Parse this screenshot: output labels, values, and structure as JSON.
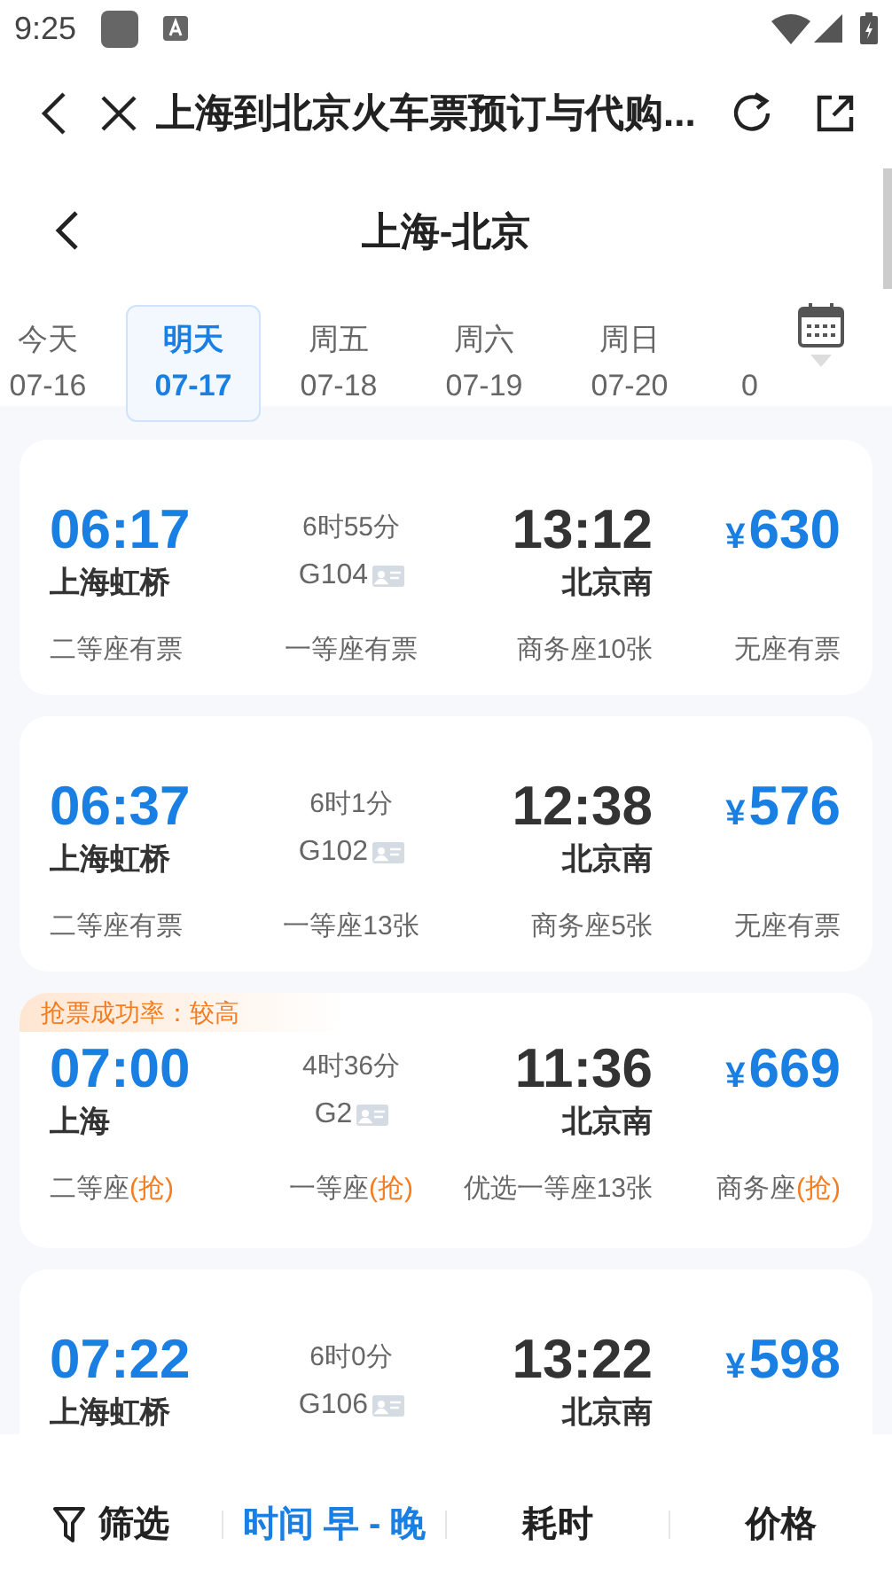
{
  "status_bar": {
    "time": "9:25"
  },
  "browser_bar": {
    "title": "上海到北京火车票预订与代购..."
  },
  "header": {
    "title": "上海-北京"
  },
  "dates": [
    {
      "day": "今天",
      "date": "07-16",
      "selected": false
    },
    {
      "day": "明天",
      "date": "07-17",
      "selected": true
    },
    {
      "day": "周五",
      "date": "07-18",
      "selected": false
    },
    {
      "day": "周六",
      "date": "07-19",
      "selected": false
    },
    {
      "day": "周日",
      "date": "07-20",
      "selected": false
    },
    {
      "date": "0",
      "selected": false
    }
  ],
  "trains": [
    {
      "depart": "06:17",
      "from": "上海虹桥",
      "duration": "6时55分",
      "number": "G104",
      "arrive": "13:12",
      "to": "北京南",
      "price": "630",
      "seats": [
        {
          "text": "二等座有票"
        },
        {
          "text": "一等座有票"
        },
        {
          "text": "商务座10张"
        },
        {
          "text": "无座有票"
        }
      ]
    },
    {
      "depart": "06:37",
      "from": "上海虹桥",
      "duration": "6时1分",
      "number": "G102",
      "arrive": "12:38",
      "to": "北京南",
      "price": "576",
      "seats": [
        {
          "text": "二等座有票"
        },
        {
          "text": "一等座13张"
        },
        {
          "text": "商务座5张"
        },
        {
          "text": "无座有票"
        }
      ]
    },
    {
      "tag": "抢票成功率：较高",
      "depart": "07:00",
      "from": "上海",
      "duration": "4时36分",
      "number": "G2",
      "arrive": "11:36",
      "to": "北京南",
      "price": "669",
      "seats": [
        {
          "text": "二等座",
          "grab": "(抢)"
        },
        {
          "text": "一等座",
          "grab": "(抢)"
        },
        {
          "text": "优选一等座13张"
        },
        {
          "text": "商务座",
          "grab": "(抢)"
        }
      ]
    },
    {
      "depart": "07:22",
      "from": "上海虹桥",
      "duration": "6时0分",
      "number": "G106",
      "arrive": "13:22",
      "to": "北京南",
      "price": "598"
    }
  ],
  "currency": "¥",
  "sort_bar": [
    {
      "kind": "filter",
      "label": "筛选",
      "selected": false
    },
    {
      "kind": "sort",
      "label": "时间 早 - 晚",
      "selected": true
    },
    {
      "kind": "sort",
      "label": "耗时",
      "selected": false
    },
    {
      "kind": "sort",
      "label": "价格",
      "selected": false
    }
  ]
}
